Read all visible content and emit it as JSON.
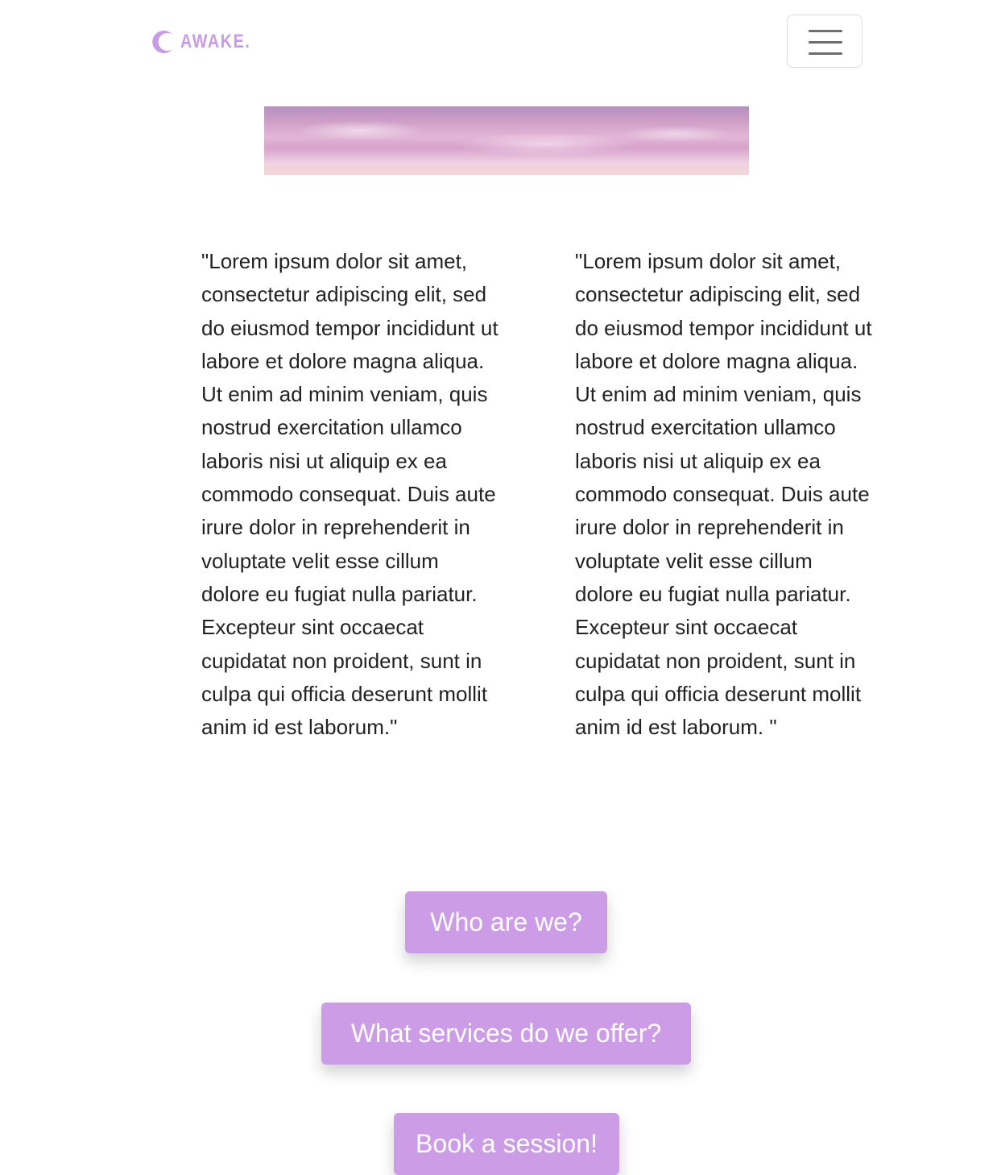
{
  "navbar": {
    "brand_text": "AWAKE.",
    "brand_icon": "crescent-moon-icon",
    "menu_icon": "hamburger-menu-icon"
  },
  "hero": {
    "image": "pink-clouds-sky-banner"
  },
  "content": {
    "left_text": "\"Lorem ipsum dolor sit amet, consectetur adipiscing elit, sed do eiusmod tempor incididunt ut labore et dolore magna aliqua. Ut enim ad minim veniam, quis nostrud exercitation ullamco laboris nisi ut aliquip ex ea commodo consequat. Duis aute irure dolor in reprehenderit in voluptate velit esse cillum dolore eu fugiat nulla pariatur. Excepteur sint occaecat cupidatat non proident, sunt in culpa qui officia deserunt mollit anim id est laborum.\"",
    "right_text": "\"Lorem ipsum dolor sit amet, consectetur adipiscing elit, sed do eiusmod tempor incididunt ut labore et dolore magna aliqua. Ut enim ad minim veniam, quis nostrud exercitation ullamco laboris nisi ut aliquip ex ea commodo consequat. Duis aute irure dolor in reprehenderit in voluptate velit esse cillum dolore eu fugiat nulla pariatur. Excepteur sint occaecat cupidatat non proident, sunt in culpa qui officia deserunt mollit anim id est laborum. \""
  },
  "buttons": {
    "who_label": "Who are we?",
    "services_label": "What services do we offer?",
    "book_label": "Book a session!"
  },
  "colors": {
    "accent": "#cc9de6",
    "brand": "#c79be6",
    "text": "#222222"
  }
}
